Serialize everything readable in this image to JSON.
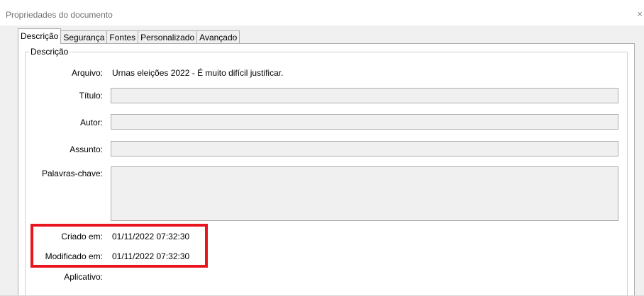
{
  "window": {
    "title": "Propriedades do documento",
    "close_glyph": "×"
  },
  "tabs": [
    {
      "label": "Descrição",
      "active": true
    },
    {
      "label": "Segurança"
    },
    {
      "label": "Fontes"
    },
    {
      "label": "Personalizado"
    },
    {
      "label": "Avançado"
    }
  ],
  "group": {
    "legend": "Descrição"
  },
  "fields": {
    "arquivo": {
      "label": "Arquivo:",
      "value": "Urnas eleições 2022 - É muito difícil justificar."
    },
    "titulo": {
      "label": "Título:",
      "value": ""
    },
    "autor": {
      "label": "Autor:",
      "value": ""
    },
    "assunto": {
      "label": "Assunto:",
      "value": ""
    },
    "palavras": {
      "label": "Palavras-chave:",
      "value": ""
    },
    "criado": {
      "label": "Criado em:",
      "value": "01/11/2022 07:32:30"
    },
    "modificado": {
      "label": "Modificado em:",
      "value": "01/11/2022 07:32:30"
    },
    "aplicativo": {
      "label": "Aplicativo:",
      "value": ""
    }
  },
  "colors": {
    "highlight": "#e8141e",
    "field_bg": "#f0f0f0",
    "panel_bg": "#ffffff"
  }
}
